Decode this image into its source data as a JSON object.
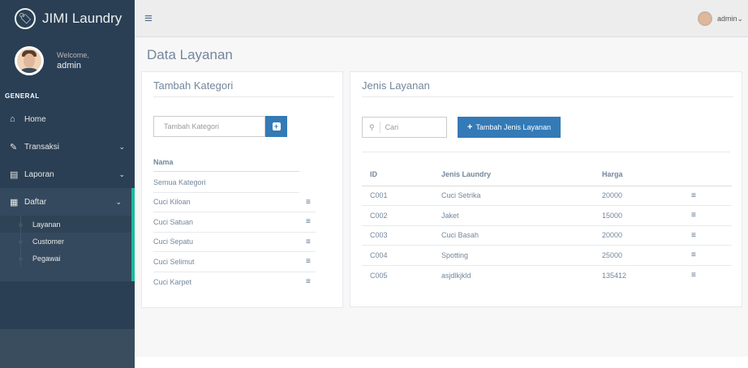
{
  "app": {
    "brand": "JIMI Laundry"
  },
  "profile": {
    "welcome": "Welcome,",
    "username": "admin"
  },
  "sidebar": {
    "section": "GENERAL",
    "items": [
      {
        "label": "Home",
        "icon": "home-icon",
        "glyph": "⌂"
      },
      {
        "label": "Transaksi",
        "icon": "edit-icon",
        "glyph": "✎",
        "chevron": "⌄"
      },
      {
        "label": "Laporan",
        "icon": "report-icon",
        "glyph": "▤",
        "chevron": "⌄"
      },
      {
        "label": "Daftar",
        "icon": "table-icon",
        "glyph": "▦",
        "chevron": "⌄"
      }
    ],
    "subitems": [
      "Layanan",
      "Customer",
      "Pegawai"
    ]
  },
  "topnav": {
    "user": "admin",
    "caret": "⌄",
    "burger": "≡"
  },
  "page": {
    "title": "Data Layanan"
  },
  "kategori": {
    "title": "Tambah Kategori",
    "input_placeholder": "Tambah Kategori",
    "add_glyph": "+",
    "header": "Nama",
    "rows": [
      "Semua Kategori",
      "Cuci Kiloan",
      "Cuci Satuan",
      "Cuci Sepatu",
      "Cuci Selimut",
      "Cuci Karpet"
    ],
    "action_glyph": "≡"
  },
  "jenis": {
    "title": "Jenis Layanan",
    "search_placeholder": "Cari",
    "search_glyph": "⚲",
    "add_label": "Tambah Jenis Layanan",
    "add_glyph": "+",
    "columns": [
      "ID",
      "Jenis Laundry",
      "Harga"
    ],
    "rows": [
      {
        "id": "C001",
        "nama": "Cuci Setrika",
        "harga": "20000"
      },
      {
        "id": "C002",
        "nama": "Jaket",
        "harga": "15000"
      },
      {
        "id": "C003",
        "nama": "Cuci Basah",
        "harga": "20000"
      },
      {
        "id": "C004",
        "nama": "Spotting",
        "harga": "25000"
      },
      {
        "id": "C005",
        "nama": "asjdlkjkld",
        "harga": "135412"
      }
    ],
    "action_glyph": "≡"
  },
  "colors": {
    "sidebar": "#2a3f54",
    "accent": "#1abb9c",
    "primary": "#337ab7"
  }
}
